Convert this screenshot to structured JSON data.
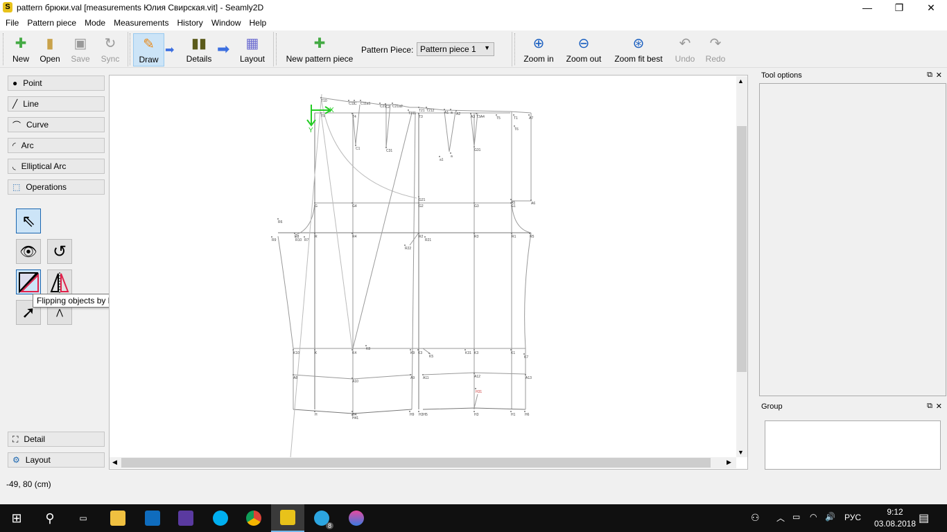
{
  "window": {
    "title": "pattern брюки.val [measurements Юлия Свирская.vit] - Seamly2D",
    "logo": "S",
    "minimize": "—",
    "maximize": "❐",
    "close": "✕"
  },
  "menu": [
    "File",
    "Pattern piece",
    "Mode",
    "Measurements",
    "History",
    "Window",
    "Help"
  ],
  "toolbar": {
    "new": "New",
    "open": "Open",
    "save": "Save",
    "sync": "Sync",
    "draw": "Draw",
    "details": "Details",
    "layout": "Layout",
    "new_piece": "New pattern piece",
    "pattern_piece_label": "Pattern Piece:",
    "pattern_piece_value": "Pattern piece 1",
    "zoom_in": "Zoom in",
    "zoom_out": "Zoom out",
    "zoom_fit": "Zoom fit best",
    "undo": "Undo",
    "redo": "Redo"
  },
  "left": {
    "groups": [
      "Point",
      "Line",
      "Curve",
      "Arc",
      "Elliptical Arc",
      "Operations"
    ],
    "detail": "Detail",
    "layout": "Layout",
    "tooltip": "Flipping objects by line"
  },
  "canvas": {
    "axis_x": "X",
    "axis_y": "Y",
    "labels": [
      "T10",
      "T9",
      "C11",
      "C",
      "C11a1",
      "C21",
      "C2",
      "C21a2",
      "T311",
      "T21",
      "T212",
      "T3",
      "T4",
      "C1",
      "C31",
      "A1",
      "a",
      "A2",
      "A3",
      "T3A4",
      "T5",
      "T1",
      "A7",
      "T6",
      "G31",
      "a1",
      "a",
      "G21",
      "G",
      "G4",
      "G2",
      "G3",
      "G1",
      "A5",
      "A6",
      "R6",
      "R9",
      "R8",
      "R10",
      "R7",
      "R",
      "R4",
      "R2",
      "R21",
      "R22",
      "R3",
      "R1",
      "R5",
      "K10",
      "K",
      "K4",
      "K8",
      "K9",
      "K3",
      "K5",
      "K31",
      "K3",
      "K1",
      "K7",
      "A8",
      "A10",
      "A9",
      "A11",
      "A12",
      "A13",
      "H31",
      "H",
      "H4",
      "H41",
      "H9",
      "H3H5",
      "H3",
      "H1",
      "H6"
    ]
  },
  "docks": {
    "tool_options": "Tool options",
    "group": "Group"
  },
  "status": "-49, 80 (cm)",
  "taskbar": {
    "lang": "РУС",
    "time": "9:12",
    "date": "03.08.2018",
    "telegram_badge": "8"
  }
}
